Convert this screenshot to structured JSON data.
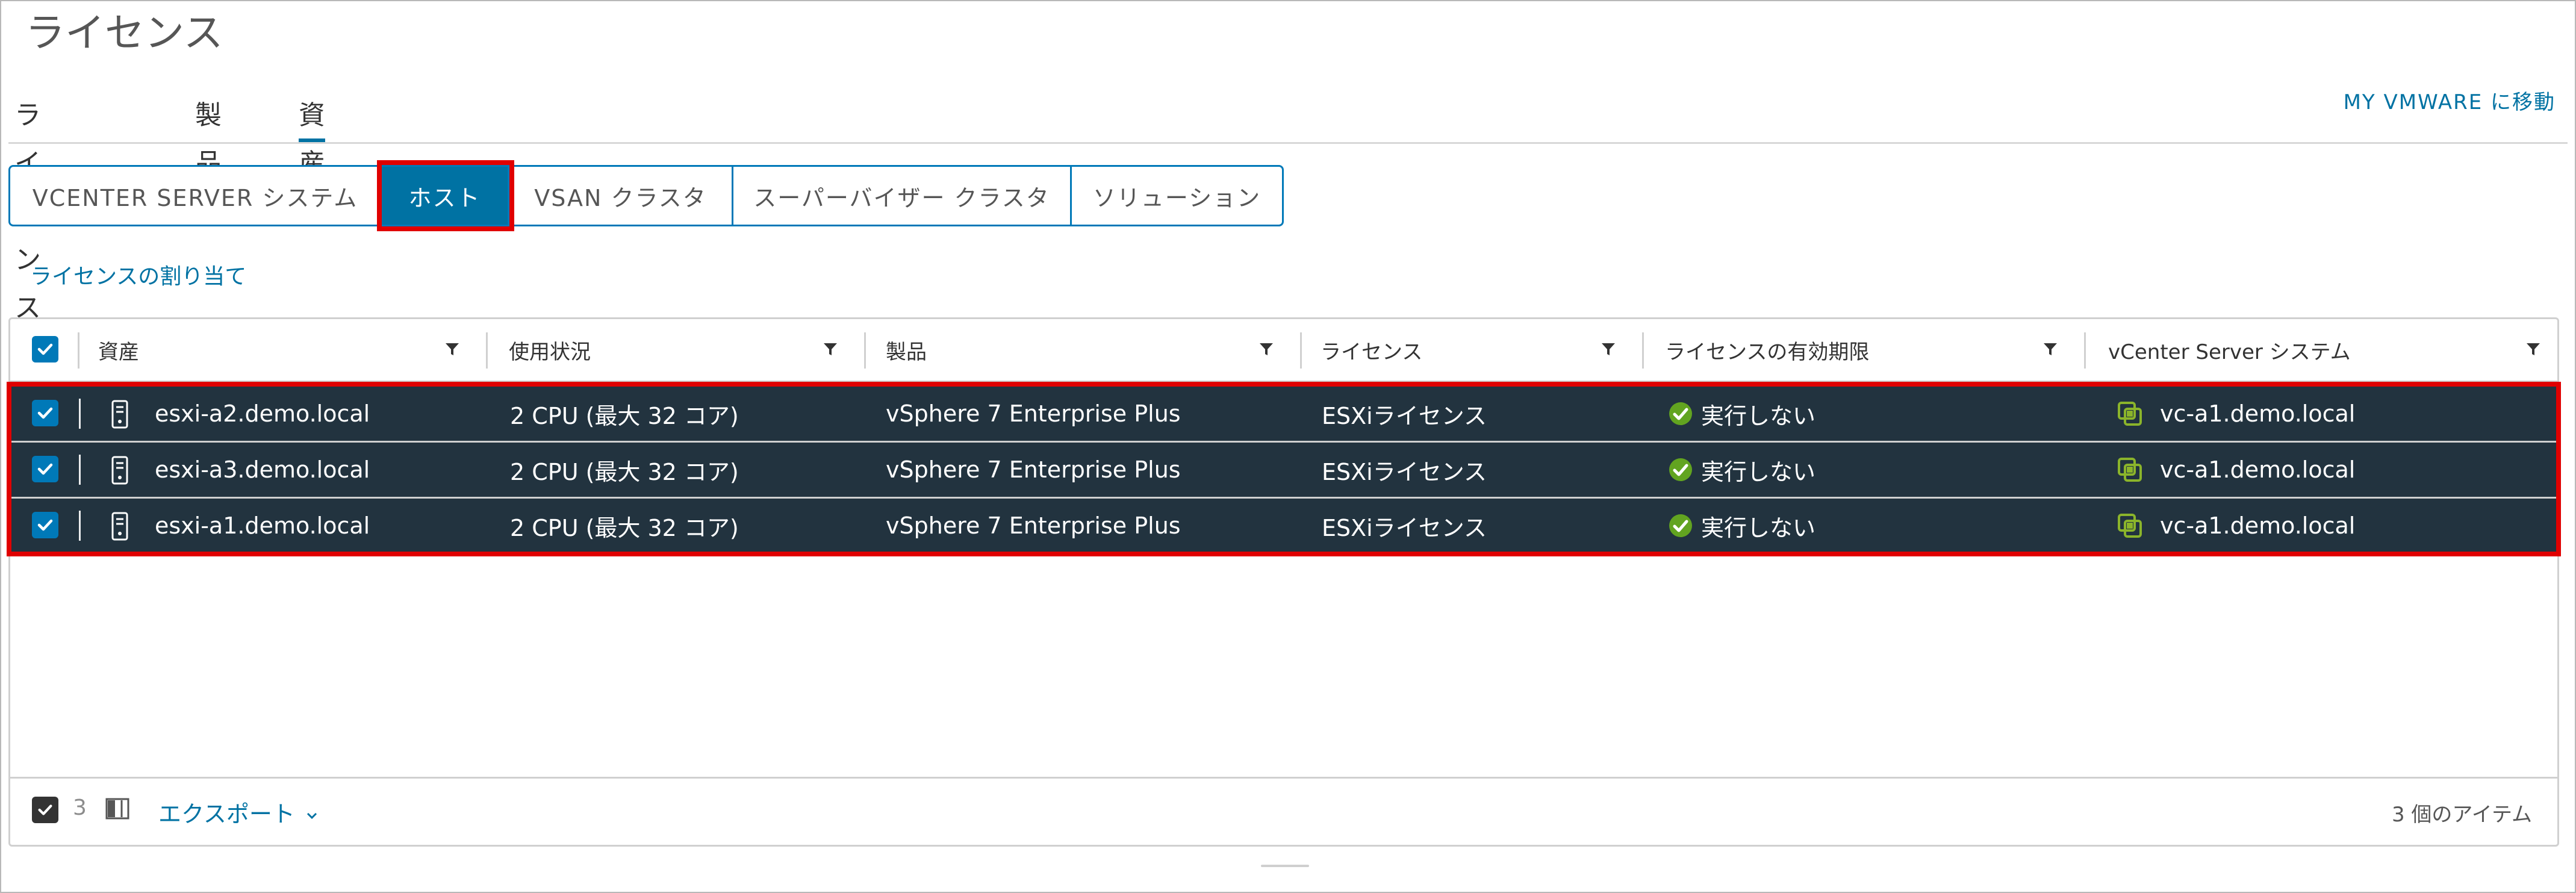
{
  "page": {
    "title": "ライセンス"
  },
  "tabs": [
    {
      "label": "ライセンス",
      "active": false
    },
    {
      "label": "製品",
      "active": false
    },
    {
      "label": "資産",
      "active": true
    }
  ],
  "my_vmware_link": "MY VMWARE に移動",
  "asset_types": [
    {
      "label": "VCENTER SERVER システム",
      "active": false
    },
    {
      "label": "ホスト",
      "active": true
    },
    {
      "label": "VSAN クラスタ",
      "active": false
    },
    {
      "label": "スーパーバイザー クラスタ",
      "active": false
    },
    {
      "label": "ソリューション",
      "active": false
    }
  ],
  "assign_license_link": "ライセンスの割り当て",
  "grid": {
    "columns": [
      "資産",
      "使用状況",
      "製品",
      "ライセンス",
      "ライセンスの有効期限",
      "vCenter Server システム"
    ],
    "rows": [
      {
        "asset": "esxi-a2.demo.local",
        "usage": "2 CPU (最大 32 コア)",
        "product": "vSphere 7 Enterprise Plus",
        "license": "ESXiライセンス",
        "expiration": "実行しない",
        "vcenter": "vc-a1.demo.local",
        "selected": true
      },
      {
        "asset": "esxi-a3.demo.local",
        "usage": "2 CPU (最大 32 コア)",
        "product": "vSphere 7 Enterprise Plus",
        "license": "ESXiライセンス",
        "expiration": "実行しない",
        "vcenter": "vc-a1.demo.local",
        "selected": true
      },
      {
        "asset": "esxi-a1.demo.local",
        "usage": "2 CPU (最大 32 コア)",
        "product": "vSphere 7 Enterprise Plus",
        "license": "ESXiライセンス",
        "expiration": "実行しない",
        "vcenter": "vc-a1.demo.local",
        "selected": true
      }
    ],
    "footer": {
      "selected_count": "3",
      "export_label": "エクスポート",
      "items_label": "3 個のアイテム"
    }
  },
  "colors": {
    "accent": "#0072a3",
    "selected_row": "#22333f",
    "highlight": "#e00000",
    "ok_green": "#62a420",
    "vc_icon": "#8bb42b"
  }
}
